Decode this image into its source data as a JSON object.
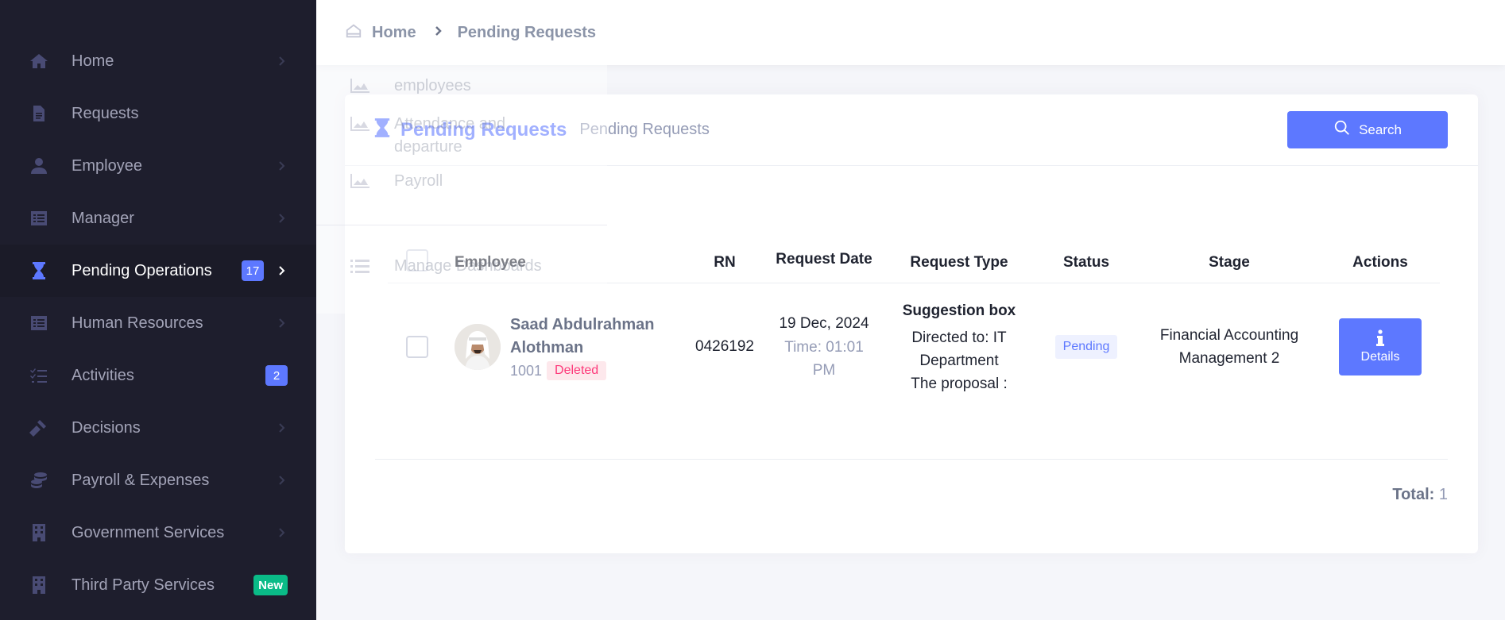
{
  "sidebar": {
    "items": [
      {
        "label": "Home",
        "icon": "home-icon",
        "badge": "",
        "active": false
      },
      {
        "label": "Requests",
        "icon": "document-icon",
        "badge": "",
        "active": false
      },
      {
        "label": "Employee",
        "icon": "person-icon",
        "badge": "",
        "active": false
      },
      {
        "label": "Manager",
        "icon": "list-icon",
        "badge": "",
        "active": false
      },
      {
        "label": "Pending Operations",
        "icon": "hourglass-icon",
        "badge": "17",
        "active": true
      },
      {
        "label": "Human Resources",
        "icon": "list-icon",
        "badge": "",
        "active": false
      },
      {
        "label": "Activities",
        "icon": "checklist-icon",
        "badge": "2",
        "active": false
      },
      {
        "label": "Decisions",
        "icon": "gavel-icon",
        "badge": "",
        "active": false
      },
      {
        "label": "Payroll & Expenses",
        "icon": "coins-icon",
        "badge": "",
        "active": false
      },
      {
        "label": "Government Services",
        "icon": "building-icon",
        "badge": "",
        "active": false
      },
      {
        "label": "Third Party Services",
        "icon": "building-icon",
        "badge": "New",
        "active": false
      }
    ]
  },
  "breadcrumb": {
    "home": "Home",
    "current": "Pending Requests"
  },
  "ghost_menu": {
    "items": [
      "employees",
      "Attendance and departure",
      "Payroll",
      "Manage Dashboards"
    ]
  },
  "card": {
    "title": "Pending Requests",
    "subtitle": "Pending Requests",
    "search_label": "Search"
  },
  "table": {
    "headers": {
      "employee": "Employee",
      "rn": "RN",
      "request_date": "Request Date",
      "request_type": "Request Type",
      "status": "Status",
      "stage": "Stage",
      "actions": "Actions"
    },
    "rows": [
      {
        "employee_name": "Saad Abdulrahman Alothman",
        "employee_id": "1001",
        "employee_tag": "Deleted",
        "rn": "0426192",
        "date": "19 Dec, 2024",
        "time": "Time:   01:01 PM",
        "type_title": "Suggestion box",
        "type_directed": "Directed to: IT Department",
        "type_proposal": "The proposal :",
        "status": "Pending",
        "stage": "Financial Accounting Management 2",
        "action_label": "Details"
      }
    ]
  },
  "footer": {
    "total_label": "Total:",
    "total_value": "1"
  },
  "colors": {
    "accent": "#5d78ff",
    "sidebar_bg": "#1e1e2d",
    "success": "#0abb87",
    "danger": "#fd397a"
  }
}
